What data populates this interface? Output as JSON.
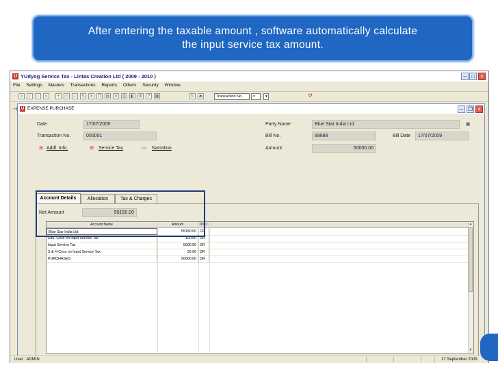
{
  "callout": {
    "line1": "After entering the taxable amount , software automatically calculate",
    "line2": "the input service tax amount."
  },
  "app": {
    "title": "YUdyog Service Tax  -  Lintas Creation Ltd ( 2009 - 2010 )",
    "logo": "U",
    "menu": [
      "File",
      "Settings",
      "Masters",
      "Transactions",
      "Reports",
      "Others",
      "Security",
      "Window"
    ],
    "toolbar_select": "Transaction No.",
    "toolbar_select2": "=",
    "status_user": "User : ADMIN",
    "status_date": "17 September 2009"
  },
  "child": {
    "title": "EXPENSE PURCHASE",
    "logo": "U"
  },
  "form": {
    "date_label": "Date",
    "date_value": "17/07/2009",
    "trans_label": "Transaction No.",
    "trans_value": "000001",
    "party_label": "Party Name",
    "party_value": "Blue Star India Ltd",
    "billno_label": "Bill No.",
    "billno_value": "89888",
    "billdate_label": "Bill Date",
    "billdate_value": "17/07/2009",
    "amount_label": "Amount",
    "amount_value": "50000.00",
    "addl_info": "Addl. Info.",
    "service_tax": "Service Tax",
    "narration": "Narration"
  },
  "tabs": [
    "Account Details",
    "Allocation",
    "Tax & Charges"
  ],
  "net_amount_label": "Net Amount",
  "net_amount_value": "55150.00",
  "grid": {
    "headers": [
      "Account Name",
      "Amount",
      "Dr/Cr"
    ],
    "rows": [
      {
        "name": "Blue Star India Ltd",
        "amount": "55150.00",
        "drcr": "CR"
      },
      {
        "name": "Edu. Cess on Input Service Tax",
        "amount": "100.00",
        "drcr": "DR"
      },
      {
        "name": "Input Service Tax",
        "amount": "5000.00",
        "drcr": "DR"
      },
      {
        "name": "S & H Cess on Input Service Tax",
        "amount": "50.00",
        "drcr": "DR"
      },
      {
        "name": "PURCHASES",
        "amount": "50000.00",
        "drcr": "DR"
      }
    ]
  },
  "colors": {
    "callout": "#1f67c2",
    "highlight": "#1d3c7a",
    "logo": "#c0392b"
  }
}
